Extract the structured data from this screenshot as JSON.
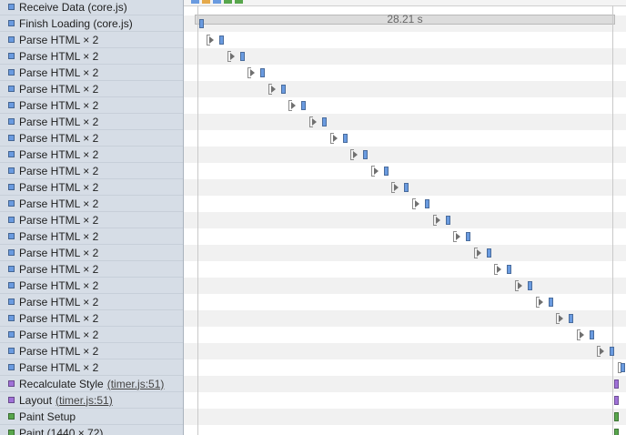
{
  "colors": {
    "blue": "#6a9be0",
    "purple": "#a071d8",
    "green": "#58a64c"
  },
  "timeline": {
    "ruler_label": "28.21 s"
  },
  "records": [
    {
      "label": "Receive Data (core.js)",
      "color": "blue"
    },
    {
      "label": "Finish Loading (core.js)",
      "color": "blue"
    },
    {
      "label": "Parse HTML × 2",
      "color": "blue",
      "expandable": true
    },
    {
      "label": "Parse HTML × 2",
      "color": "blue",
      "expandable": true
    },
    {
      "label": "Parse HTML × 2",
      "color": "blue",
      "expandable": true
    },
    {
      "label": "Parse HTML × 2",
      "color": "blue",
      "expandable": true
    },
    {
      "label": "Parse HTML × 2",
      "color": "blue",
      "expandable": true
    },
    {
      "label": "Parse HTML × 2",
      "color": "blue",
      "expandable": true
    },
    {
      "label": "Parse HTML × 2",
      "color": "blue",
      "expandable": true
    },
    {
      "label": "Parse HTML × 2",
      "color": "blue",
      "expandable": true
    },
    {
      "label": "Parse HTML × 2",
      "color": "blue",
      "expandable": true
    },
    {
      "label": "Parse HTML × 2",
      "color": "blue",
      "expandable": true
    },
    {
      "label": "Parse HTML × 2",
      "color": "blue",
      "expandable": true
    },
    {
      "label": "Parse HTML × 2",
      "color": "blue",
      "expandable": true
    },
    {
      "label": "Parse HTML × 2",
      "color": "blue",
      "expandable": true
    },
    {
      "label": "Parse HTML × 2",
      "color": "blue",
      "expandable": true
    },
    {
      "label": "Parse HTML × 2",
      "color": "blue",
      "expandable": true
    },
    {
      "label": "Parse HTML × 2",
      "color": "blue",
      "expandable": true
    },
    {
      "label": "Parse HTML × 2",
      "color": "blue",
      "expandable": true
    },
    {
      "label": "Parse HTML × 2",
      "color": "blue",
      "expandable": true
    },
    {
      "label": "Parse HTML × 2",
      "color": "blue",
      "expandable": true
    },
    {
      "label": "Parse HTML × 2",
      "color": "blue",
      "expandable": true
    },
    {
      "label": "Parse HTML × 2",
      "color": "blue",
      "expandable": true
    },
    {
      "label": "Recalculate Style",
      "link": "(timer.js:51)",
      "color": "purple"
    },
    {
      "label": "Layout",
      "link": "(timer.js:51)",
      "color": "purple"
    },
    {
      "label": "Paint Setup",
      "color": "green"
    },
    {
      "label": "Paint (1440 × 72)",
      "color": "green"
    }
  ]
}
